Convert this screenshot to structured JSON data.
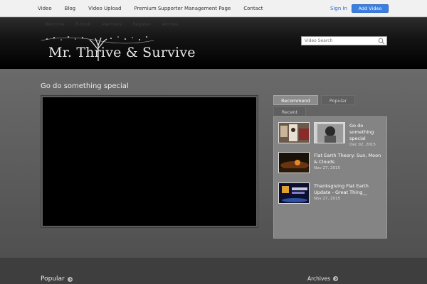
{
  "topnav": {
    "items": [
      "Video",
      "Blog",
      "Video Upload",
      "Premium Supporter Management Page",
      "Contact"
    ],
    "sign_in": "Sign In",
    "add_video": "Add Video"
  },
  "header": {
    "subnav": [
      "Welcome",
      "E-book",
      "Members",
      "Register",
      "Articles"
    ],
    "logo_text": "Mr. Thrive & Survive",
    "search_placeholder": "Video Search",
    "icons": {
      "search": "magnifier-icon",
      "logo": "tree-icon"
    }
  },
  "main": {
    "video_title": "Go do something special",
    "tabs": [
      "Recommend",
      "Popular",
      "Recent"
    ],
    "active_tab": "Recommend",
    "items": [
      {
        "title": "Go do something special",
        "date": "Dec 02, 2015"
      },
      {
        "title": "Flat Earth Theory: Sun, Moon & Clouds",
        "date": "Nov 27, 2015"
      },
      {
        "title": "Thanksgiving Flat Earth Update - Great Thing__",
        "date": "Nov 27, 2015"
      }
    ]
  },
  "footer": {
    "popular": "Popular",
    "archives": "Archives"
  },
  "colors": {
    "accent": "#3b7fe0",
    "link": "#2a6ad3",
    "active_tab": "#8c8c8c"
  }
}
